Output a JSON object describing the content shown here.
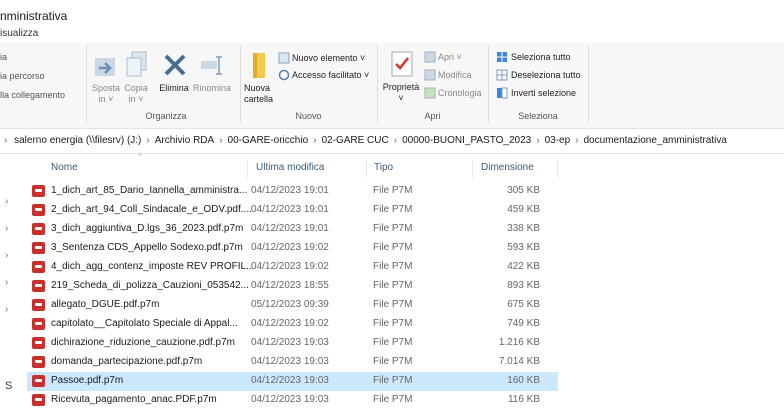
{
  "window": {
    "title": "nministrativa",
    "ribbon_tab": "isualizza"
  },
  "ribbon": {
    "left_items": [
      "ia",
      "ia percorso",
      "lla collegamento"
    ],
    "organize": {
      "sposta": "Sposta\nin ˅",
      "copia": "Copia\nin ˅",
      "elimina": "Elimina",
      "rinomina": "Rinomina",
      "group": "Organizza"
    },
    "new": {
      "nuova_cartella": "Nuova\ncartella",
      "nuovo_elemento": "Nuovo elemento ˅",
      "accesso_facilitato": "Accesso facilitato ˅",
      "group": "Nuovo"
    },
    "open": {
      "proprieta": "Proprietà\n˅",
      "apri": "Apri ˅",
      "modifica": "Modifica",
      "cronologia": "Cronologia",
      "group": "Apri"
    },
    "select": {
      "seleziona_tutto": "Seleziona tutto",
      "deseleziona_tutto": "Deseleziona tutto",
      "inverti_selezione": "Inverti selezione",
      "group": "Seleziona"
    }
  },
  "address": {
    "breadcrumbs": [
      "salerno energia (\\\\filesrv) (J:)",
      "Archivio RDA",
      "00-GARE-oricchio",
      "02-GARE CUC",
      "00000-BUONI_PASTO_2023",
      "03-ep",
      "documentazione_amministrativa"
    ],
    "separator": "›"
  },
  "columns": {
    "name": "Nome",
    "modified": "Ultima modifica",
    "type": "Tipo",
    "size": "Dimensione"
  },
  "left_marks": [
    "›",
    "›",
    "›",
    "›",
    "›",
    "S"
  ],
  "files": [
    {
      "name": "1_dich_art_85_Dario_Iannella_amministra...",
      "modified": "04/12/2023 19:01",
      "type": "File P7M",
      "size": "305 KB",
      "selected": false
    },
    {
      "name": "2_dich_art_94_Coll_Sindacale_e_ODV.pdf....",
      "modified": "04/12/2023 19:01",
      "type": "File P7M",
      "size": "459 KB",
      "selected": false
    },
    {
      "name": "3_dich_aggiuntiva_D.lgs_36_2023.pdf.p7m",
      "modified": "04/12/2023 19:01",
      "type": "File P7M",
      "size": "338 KB",
      "selected": false
    },
    {
      "name": "3_Sentenza CDS_Appello Sodexo.pdf.p7m",
      "modified": "04/12/2023 19:02",
      "type": "File P7M",
      "size": "593 KB",
      "selected": false
    },
    {
      "name": "4_dich_agg_contenz_imposte REV PROFIL...",
      "modified": "04/12/2023 19:02",
      "type": "File P7M",
      "size": "422 KB",
      "selected": false
    },
    {
      "name": "219_Scheda_di_polizza_Cauzioni_053542...",
      "modified": "04/12/2023 18:55",
      "type": "File P7M",
      "size": "893 KB",
      "selected": false
    },
    {
      "name": "allegato_DGUE.pdf.p7m",
      "modified": "05/12/2023 09:39",
      "type": "File P7M",
      "size": "675 KB",
      "selected": false
    },
    {
      "name": "capitolato__Capitolato Speciale di Appal...",
      "modified": "04/12/2023 19:02",
      "type": "File P7M",
      "size": "749 KB",
      "selected": false
    },
    {
      "name": "dichirazione_riduzione_cauzione.pdf.p7m",
      "modified": "04/12/2023 19:03",
      "type": "File P7M",
      "size": "1.216 KB",
      "selected": false
    },
    {
      "name": "domanda_partecipazione.pdf.p7m",
      "modified": "04/12/2023 19:03",
      "type": "File P7M",
      "size": "7.014 KB",
      "selected": false
    },
    {
      "name": "Passoe.pdf.p7m",
      "modified": "04/12/2023 19:03",
      "type": "File P7M",
      "size": "160 KB",
      "selected": true
    },
    {
      "name": "Ricevuta_pagamento_anac.PDF.p7m",
      "modified": "04/12/2023 19:03",
      "type": "File P7M",
      "size": "116 KB",
      "selected": false
    }
  ],
  "colors": {
    "selected_row": "#cce8ff",
    "pdf_icon": "#c9302c",
    "header_text": "#3c5a7a"
  }
}
